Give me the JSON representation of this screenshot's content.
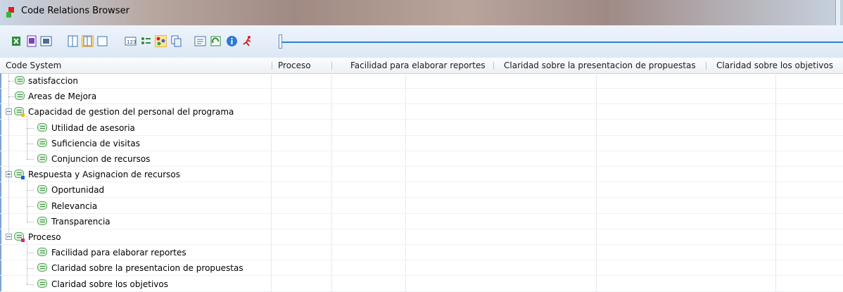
{
  "window": {
    "title": "Code Relations Browser"
  },
  "toolbar": {
    "icons": [
      "export-excel-icon",
      "export-html-icon",
      "export-image-icon",
      "layout-columns-icon",
      "layout-columns-active-icon",
      "layout-single-icon",
      "numbers-icon",
      "code-list-icon",
      "highlight-relations-icon",
      "copy-icon",
      "code-symbol-icon",
      "refresh-icon",
      "info-icon",
      "run-icon"
    ],
    "accent": "#2f7fd6"
  },
  "table": {
    "columns": [
      "Code System",
      "Proceso",
      "Facilidad para elaborar reportes",
      "Claridad sobre la presentacion de propuestas",
      "Claridad sobre los objetivos"
    ],
    "rows": [
      {
        "label": "satisfaccion",
        "level": 0,
        "expandable": false
      },
      {
        "label": "Areas de Mejora",
        "level": 0,
        "expandable": false
      },
      {
        "label": "Capacidad de gestion del personal del programa",
        "level": 0,
        "expandable": true,
        "marker_color": "#f2c01a"
      },
      {
        "label": "Utilidad de asesoria",
        "level": 1,
        "expandable": false
      },
      {
        "label": "Suficiencia de visitas",
        "level": 1,
        "expandable": false
      },
      {
        "label": "Conjuncion de recursos",
        "level": 1,
        "expandable": false
      },
      {
        "label": "Respuesta y Asignacion de recursos",
        "level": 0,
        "expandable": true,
        "marker_color": "#1f5fc8"
      },
      {
        "label": "Oportunidad",
        "level": 1,
        "expandable": false
      },
      {
        "label": "Relevancia",
        "level": 1,
        "expandable": false
      },
      {
        "label": "Transparencia",
        "level": 1,
        "expandable": false
      },
      {
        "label": "Proceso",
        "level": 0,
        "expandable": true,
        "marker_color": "#e0218a"
      },
      {
        "label": "Facilidad para elaborar reportes",
        "level": 1,
        "expandable": false
      },
      {
        "label": "Claridad sobre la presentacion de propuestas",
        "level": 1,
        "expandable": false
      },
      {
        "label": "Claridad sobre los objetivos",
        "level": 1,
        "expandable": false
      }
    ]
  }
}
